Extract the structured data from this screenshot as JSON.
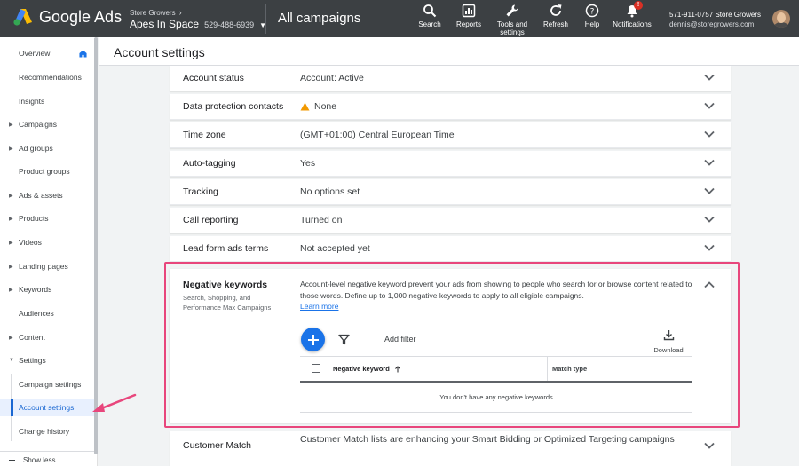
{
  "app": {
    "name": "Google Ads"
  },
  "account": {
    "parent": "Store Growers",
    "name": "Apes In Space",
    "id": "529-488-6939"
  },
  "scope": "All campaigns",
  "toolbar": [
    {
      "id": "search",
      "label": "Search",
      "icon": "search-icon"
    },
    {
      "id": "reports",
      "label": "Reports",
      "icon": "reports-icon"
    },
    {
      "id": "tools",
      "label": "Tools and settings",
      "icon": "wrench-icon"
    },
    {
      "id": "refresh",
      "label": "Refresh",
      "icon": "refresh-icon"
    },
    {
      "id": "help",
      "label": "Help",
      "icon": "help-icon"
    },
    {
      "id": "notifications",
      "label": "Notifications",
      "icon": "bell-icon",
      "badge": "!"
    }
  ],
  "user": {
    "line1": "571-911-0757 Store Growers",
    "email": "dennis@storegrowers.com"
  },
  "sidebar": {
    "items": [
      {
        "label": "Overview",
        "arrow": false
      },
      {
        "label": "Recommendations",
        "arrow": false
      },
      {
        "label": "Insights",
        "arrow": false
      },
      {
        "label": "Campaigns",
        "arrow": true
      },
      {
        "label": "Ad groups",
        "arrow": true
      },
      {
        "label": "Product groups",
        "arrow": false
      },
      {
        "label": "Ads & assets",
        "arrow": true
      },
      {
        "label": "Products",
        "arrow": true
      },
      {
        "label": "Videos",
        "arrow": true
      },
      {
        "label": "Landing pages",
        "arrow": true
      },
      {
        "label": "Keywords",
        "arrow": true
      },
      {
        "label": "Audiences",
        "arrow": false
      },
      {
        "label": "Content",
        "arrow": true
      },
      {
        "label": "Settings",
        "arrow": true,
        "expanded": true
      },
      {
        "label": "Campaign settings",
        "arrow": false
      },
      {
        "label": "Account settings",
        "arrow": false,
        "active": true
      },
      {
        "label": "Change history",
        "arrow": false
      }
    ],
    "show_less": "Show less"
  },
  "page_title": "Account settings",
  "settings": [
    {
      "key": "Account status",
      "value": "Account: Active"
    },
    {
      "key": "Data protection contacts",
      "value": "None",
      "warning": true
    },
    {
      "key": "Time zone",
      "value": "(GMT+01:00) Central European Time"
    },
    {
      "key": "Auto-tagging",
      "value": "Yes"
    },
    {
      "key": "Tracking",
      "value": "No options set"
    },
    {
      "key": "Call reporting",
      "value": "Turned on"
    },
    {
      "key": "Lead form ads terms",
      "value": "Not accepted yet"
    }
  ],
  "negative_keywords": {
    "title": "Negative keywords",
    "subtitle": "Search, Shopping, and Performance Max Campaigns",
    "description": "Account-level negative keyword prevent your ads from showing to people who search for or browse content related to those words. Define up to 1,000 negative keywords to apply to all eligible campaigns.",
    "learn_more": "Learn more",
    "add_filter": "Add filter",
    "download": "Download",
    "columns": [
      "Negative keyword",
      "Match type"
    ],
    "empty_message": "You don't have any negative keywords"
  },
  "customer_match": {
    "key": "Customer Match",
    "value": "Customer Match lists are enhancing your Smart Bidding or Optimized Targeting campaigns"
  },
  "colors": {
    "topbar": "#3c4043",
    "accent_blue": "#1a73e8",
    "highlight_pink": "#e8467c",
    "warning": "#f29900"
  }
}
